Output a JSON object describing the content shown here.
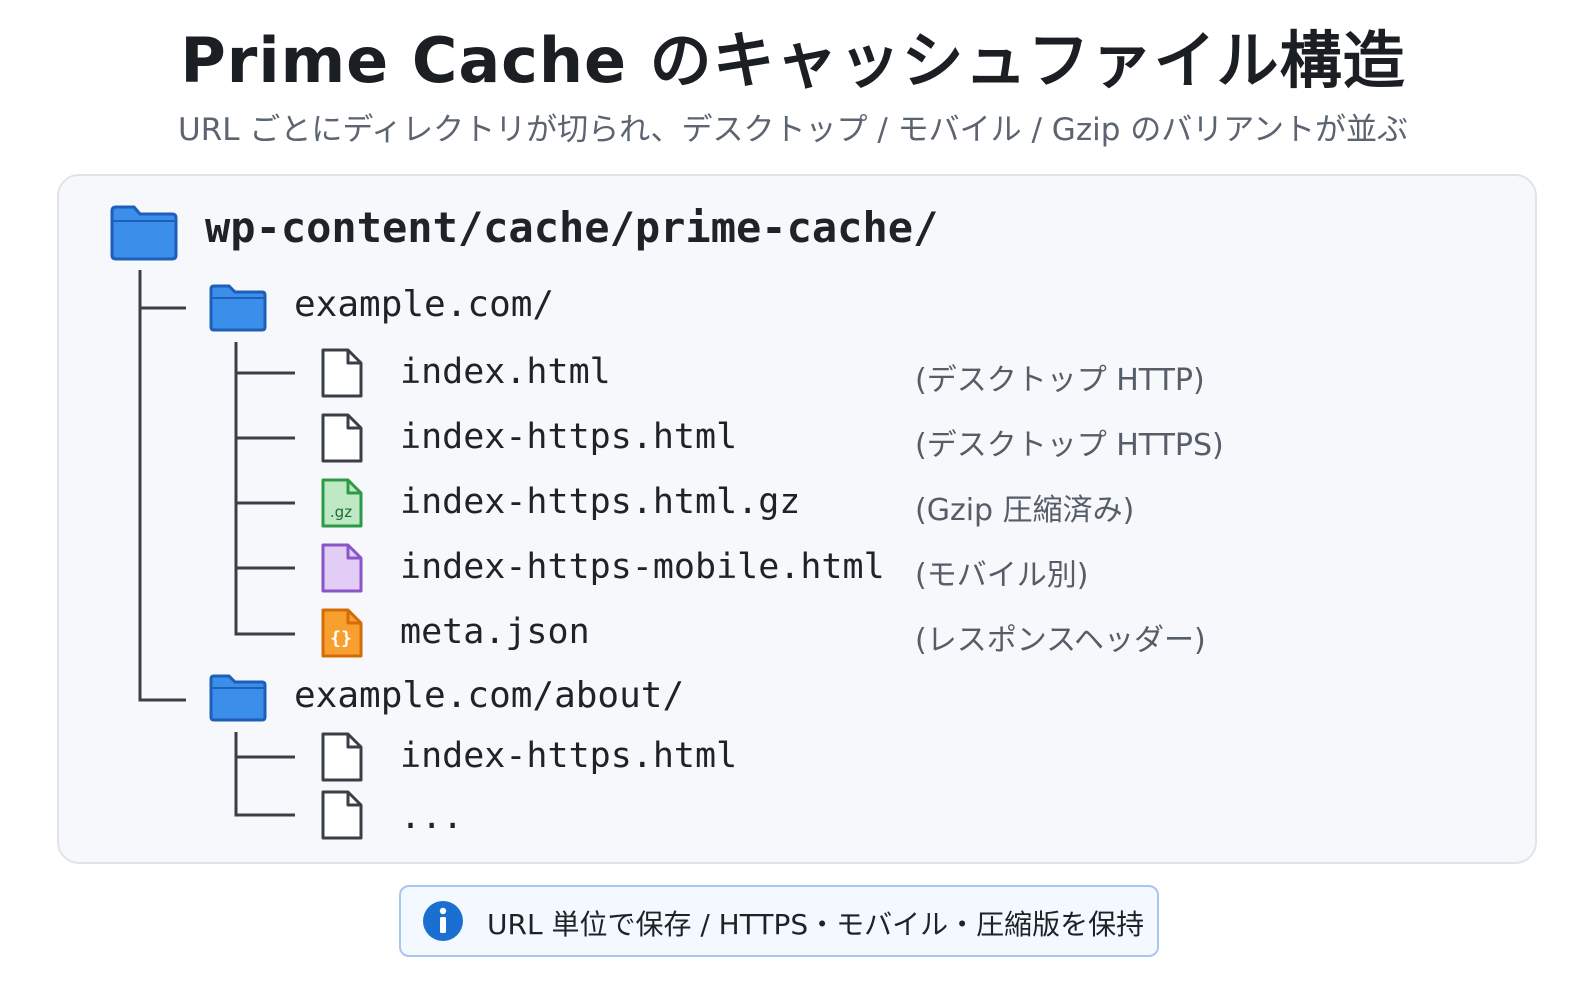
{
  "header": {
    "title": "Prime Cache のキャッシュファイル構造",
    "subtitle": "URL ごとにディレクトリが切られ、デスクトップ / モバイル / Gzip のバリアントが並ぶ"
  },
  "tree": {
    "root": {
      "name": "wp-content/cache/prime-cache/",
      "icon": "folder-icon"
    },
    "dirs": [
      {
        "name": "example.com/",
        "icon": "folder-icon",
        "files": [
          {
            "name": "index.html",
            "note": "(デスクトップ HTTP)",
            "icon": "file-icon"
          },
          {
            "name": "index-https.html",
            "note": "(デスクトップ HTTPS)",
            "icon": "file-icon"
          },
          {
            "name": "index-https.html.gz",
            "note": "(Gzip 圧縮済み)",
            "icon": "gzip-file-icon",
            "badge": ".gz"
          },
          {
            "name": "index-https-mobile.html",
            "note": "(モバイル別)",
            "icon": "mobile-file-icon"
          },
          {
            "name": "meta.json",
            "note": "(レスポンスヘッダー)",
            "icon": "json-file-icon",
            "badge": "{}"
          }
        ]
      },
      {
        "name": "example.com/about/",
        "icon": "folder-icon",
        "files": [
          {
            "name": "index-https.html",
            "icon": "file-icon"
          },
          {
            "name": "...",
            "icon": "file-icon"
          }
        ]
      }
    ]
  },
  "footer": {
    "info_text": "URL 単位で保存 / HTTPS・モバイル・圧縮版を保持",
    "info_icon": "info-icon"
  },
  "colors": {
    "folder": "#3b8eea",
    "folder_stroke": "#1e5fb8",
    "gzip": "#bfe8c4",
    "gzip_stroke": "#2d9a48",
    "mobile": "#e2cdf6",
    "mobile_stroke": "#8a55c7",
    "json": "#f7a030",
    "json_stroke": "#d46b07",
    "info": "#1a6fd0"
  }
}
